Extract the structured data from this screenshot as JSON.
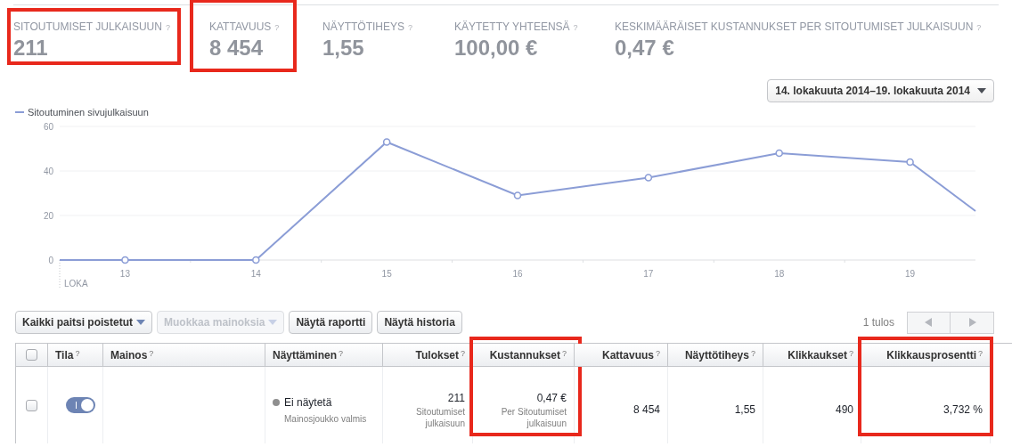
{
  "stats": [
    {
      "label": "SITOUTUMISET JULKAISUUN",
      "help": "?",
      "value": "211",
      "highlighted": true
    },
    {
      "label": "KATTAVUUS",
      "help": "?",
      "value": "8 454",
      "highlighted": true
    },
    {
      "label": "NÄYTTÖTIHEYS",
      "help": "?",
      "value": "1,55",
      "highlighted": false
    },
    {
      "label": "KÄYTETTY YHTEENSÄ",
      "help": "?",
      "value": "100,00 €",
      "highlighted": false
    },
    {
      "label": "KESKIMÄÄRÄISET KUSTANNUKSET PER SITOUTUMISET JULKAISUUN",
      "help": "?",
      "value": "0,47 €",
      "highlighted": false
    }
  ],
  "date_range": {
    "label": "14. lokakuuta 2014–19. lokakuuta 2014"
  },
  "chart": {
    "month_label": "LOKA",
    "chart_data": {
      "type": "line",
      "x": [
        12.5,
        13,
        14,
        15,
        16,
        17,
        18,
        19,
        19.5
      ],
      "xlim": [
        12.5,
        19.5
      ],
      "ylim": [
        0,
        60
      ],
      "xticks": [
        13,
        14,
        15,
        16,
        17,
        18,
        19
      ],
      "yticks": [
        0,
        20,
        40,
        60
      ],
      "series": [
        {
          "name": "Sitoutuminen sivujulkaisuun",
          "color": "#8b9dd6",
          "values": [
            0,
            0,
            0,
            53,
            29,
            37,
            48,
            44,
            22
          ]
        }
      ]
    }
  },
  "toolbar": {
    "buttons": [
      {
        "label": "Kaikki paitsi poistetut",
        "dropdown": true,
        "disabled": false
      },
      {
        "label": "Muokkaa mainoksia",
        "dropdown": true,
        "disabled": true
      },
      {
        "label": "Näytä raportti",
        "dropdown": false,
        "disabled": false
      },
      {
        "label": "Näytä historia",
        "dropdown": false,
        "disabled": false
      }
    ],
    "result_count": "1 tulos"
  },
  "table": {
    "columns": [
      {
        "kind": "checkbox",
        "highlighted": false
      },
      {
        "kind": "toggle",
        "label": "Tila",
        "help": "?",
        "highlighted": false
      },
      {
        "kind": "text",
        "label": "Mainos",
        "help": "?",
        "highlighted": false
      },
      {
        "kind": "status",
        "label": "Näyttäminen",
        "help": "?",
        "highlighted": false
      },
      {
        "kind": "number",
        "label": "Tulokset",
        "help": "?",
        "highlighted": false
      },
      {
        "kind": "number",
        "label": "Kustannukset",
        "help": "?",
        "highlighted": true
      },
      {
        "kind": "number",
        "label": "Kattavuus",
        "help": "?",
        "highlighted": false
      },
      {
        "kind": "number",
        "label": "Näyttötiheys",
        "help": "?",
        "highlighted": false
      },
      {
        "kind": "number",
        "label": "Klikkaukset",
        "help": "?",
        "highlighted": false
      },
      {
        "kind": "number",
        "label": "Klikkausprosentti",
        "help": "?",
        "highlighted": true
      }
    ],
    "header_checkbox": {
      "checked": false
    },
    "rows": [
      {
        "cells": [
          {
            "checked": false
          },
          {
            "on": true
          },
          {},
          {
            "main": "Ei näytetä",
            "sub": "Mainosjoukko valmis",
            "color": "#8f8f8f"
          },
          {
            "main": "211",
            "sub": "Sitoutumiset julkaisuun"
          },
          {
            "main": "0,47 €",
            "sub": "Per Sitoutumiset julkaisuun"
          },
          {
            "main": "8 454"
          },
          {
            "main": "1,55"
          },
          {
            "main": "490"
          },
          {
            "main": "3,732 %"
          }
        ]
      }
    ]
  }
}
